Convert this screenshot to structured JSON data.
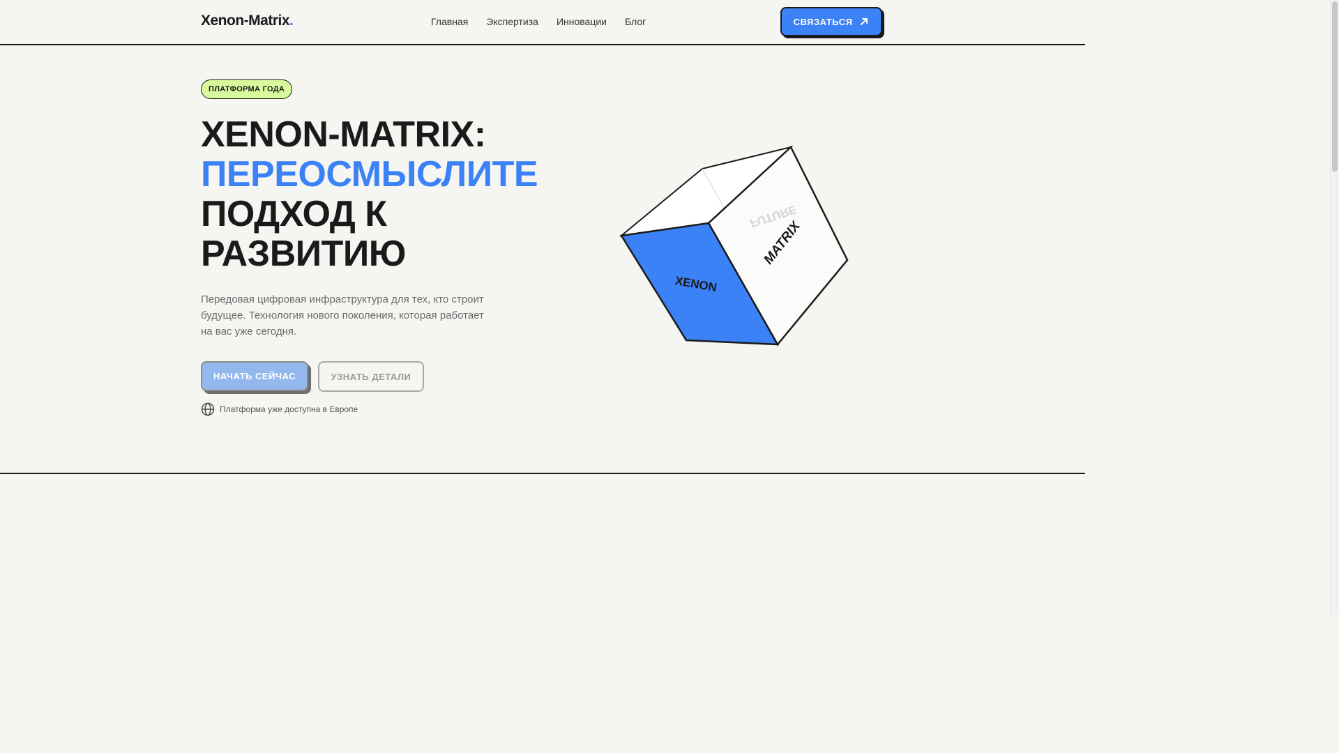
{
  "header": {
    "logo_text": "Xenon-Matrix",
    "logo_dot": ".",
    "nav": [
      {
        "label": "Главная"
      },
      {
        "label": "Экспертиза"
      },
      {
        "label": "Инновации"
      },
      {
        "label": "Блог"
      }
    ],
    "contact_label": "СВЯЗАТЬСЯ",
    "contact_icon": "arrow-up-right-icon"
  },
  "hero": {
    "badge": "ПЛАТФОРМА ГОДА",
    "title_line1": "XENON-MATRIX:",
    "title_line2": "ПЕРЕОСМЫСЛИТЕ",
    "title_line3": "ПОДХОД К",
    "title_line4": "РАЗВИТИЮ",
    "description": "Передовая цифровая инфраструктура для тех, кто строит будущее. Технология нового поколения, которая работает на вас уже сегодня.",
    "primary_button": "НАЧАТЬ СЕЙЧАС",
    "secondary_button": "УЗНАТЬ ДЕТАЛИ",
    "availability_icon": "globe-icon",
    "availability_text": "Платформа уже доступна в Европе"
  },
  "cube": {
    "face_front": "XENON",
    "face_side": "MATRIX",
    "face_back": "FUTURE"
  },
  "colors": {
    "accent": "#3b82f6",
    "badge_bg": "#d9f99d",
    "background": "#f5f5f2",
    "text": "#1a1a1a"
  }
}
